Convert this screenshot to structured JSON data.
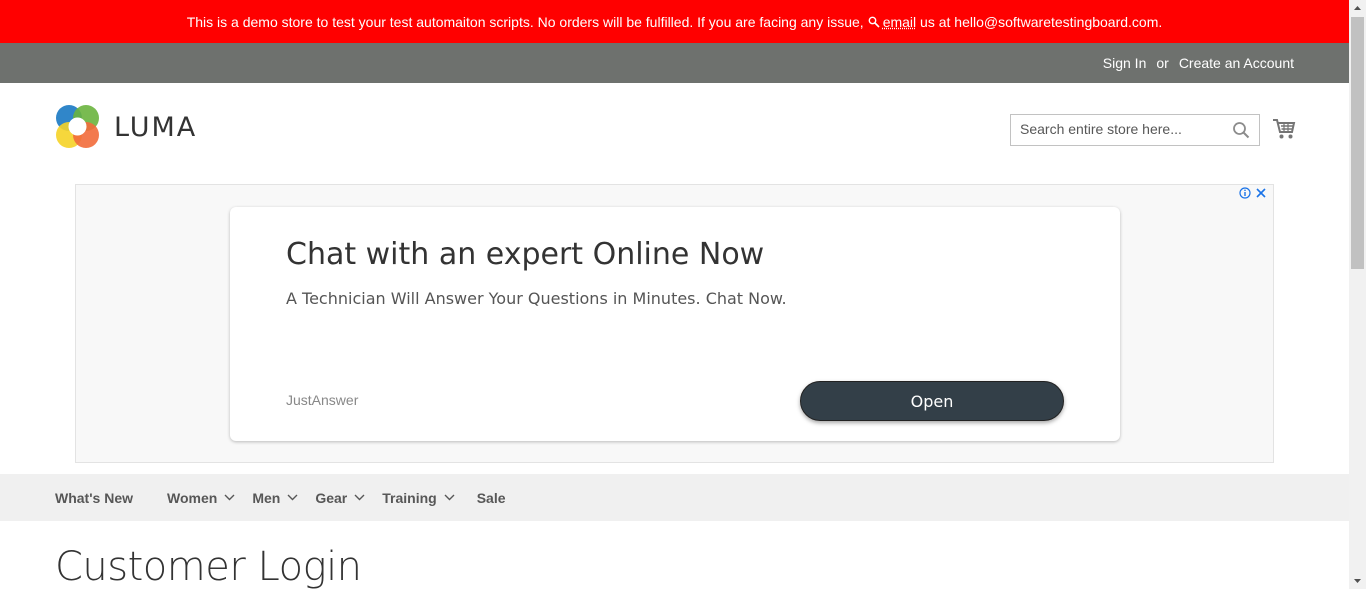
{
  "banner": {
    "text_before": "This is a demo store to test your test automaiton scripts. No orders will be fulfilled. If you are facing any issue,",
    "email_link": "email",
    "text_after": " us at hello@softwaretestingboard.com.",
    "background": "#ff0000"
  },
  "header_links": {
    "sign_in": "Sign In",
    "or": "or",
    "create_account": "Create an Account"
  },
  "logo": {
    "text": "LUMA"
  },
  "search": {
    "placeholder": "Search entire store here...",
    "value": ""
  },
  "ad": {
    "title": "Chat with an expert Online Now",
    "subtitle": "A Technician Will Answer Your Questions in Minutes. Chat Now.",
    "brand": "JustAnswer",
    "button_label": "Open"
  },
  "nav": {
    "items": [
      {
        "label": "What's New",
        "has_dropdown": false
      },
      {
        "label": "Women",
        "has_dropdown": true
      },
      {
        "label": "Men",
        "has_dropdown": true
      },
      {
        "label": "Gear",
        "has_dropdown": true
      },
      {
        "label": "Training",
        "has_dropdown": true
      },
      {
        "label": "Sale",
        "has_dropdown": false
      }
    ]
  },
  "page_title": "Customer Login",
  "icons": {
    "banner_search": "magnifier-icon",
    "search_button": "search-icon",
    "cart": "cart-icon",
    "ad_info": "info-icon",
    "ad_close": "close-icon",
    "dropdown": "chevron-down-icon"
  }
}
